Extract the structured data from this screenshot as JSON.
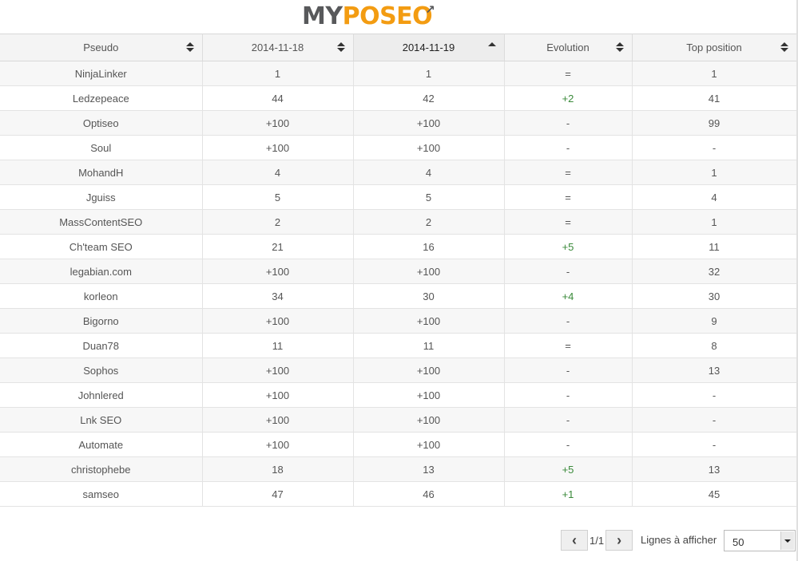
{
  "logo": {
    "part1": "MY",
    "part2": "POSEO",
    "pin": "↗"
  },
  "table": {
    "headers": [
      {
        "label": "Pseudo"
      },
      {
        "label": "2014-11-18"
      },
      {
        "label": "2014-11-19"
      },
      {
        "label": "Evolution"
      },
      {
        "label": "Top position"
      }
    ],
    "rows": [
      [
        "NinjaLinker",
        "1",
        "1",
        "=",
        "1"
      ],
      [
        "Ledzepeace",
        "44",
        "42",
        "+2",
        "41"
      ],
      [
        "Optiseo",
        "+100",
        "+100",
        "-",
        "99"
      ],
      [
        "Soul",
        "+100",
        "+100",
        "-",
        "-"
      ],
      [
        "MohandH",
        "4",
        "4",
        "=",
        "1"
      ],
      [
        "Jguiss",
        "5",
        "5",
        "=",
        "4"
      ],
      [
        "MassContentSEO",
        "2",
        "2",
        "=",
        "1"
      ],
      [
        "Ch'team SEO",
        "21",
        "16",
        "+5",
        "11"
      ],
      [
        "legabian.com",
        "+100",
        "+100",
        "-",
        "32"
      ],
      [
        "korleon",
        "34",
        "30",
        "+4",
        "30"
      ],
      [
        "Bigorno",
        "+100",
        "+100",
        "-",
        "9"
      ],
      [
        "Duan78",
        "11",
        "11",
        "=",
        "8"
      ],
      [
        "Sophos",
        "+100",
        "+100",
        "-",
        "13"
      ],
      [
        "Johnlered",
        "+100",
        "+100",
        "-",
        "-"
      ],
      [
        "Lnk SEO",
        "+100",
        "+100",
        "-",
        "-"
      ],
      [
        "Automate",
        "+100",
        "+100",
        "-",
        "-"
      ],
      [
        "christophebe",
        "18",
        "13",
        "+5",
        "13"
      ],
      [
        "samseo",
        "47",
        "46",
        "+1",
        "45"
      ]
    ]
  },
  "pagination": {
    "prev_icon": "chevron-left-icon",
    "next_icon": "chevron-right-icon",
    "prev_glyph": "‹",
    "next_glyph": "›",
    "page_info": "1/1",
    "lines_label": "Lignes à afficher",
    "lines_value": "50"
  },
  "colors": {
    "positive": "#3a8a3a",
    "logo_orange": "#f39c12",
    "logo_gray": "#58595b"
  }
}
